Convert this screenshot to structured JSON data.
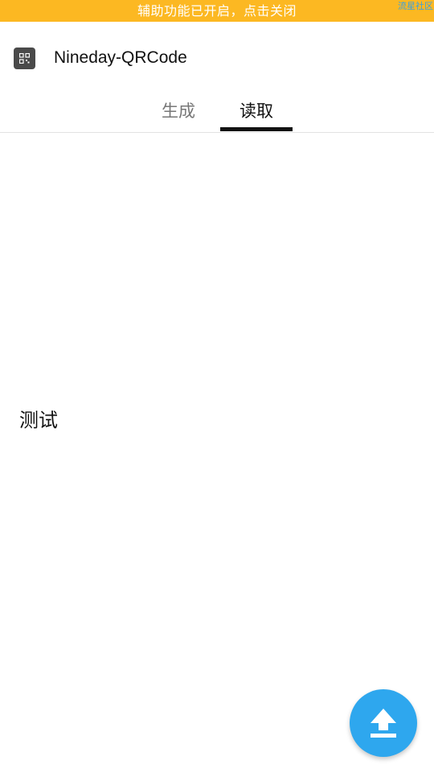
{
  "status_banner": {
    "text": "辅助功能已开启，点击关闭",
    "watermark": "流星社区",
    "background_color": "#fcb822"
  },
  "app_bar": {
    "icon": "qr-code-icon",
    "title": "Nineday-QRCode"
  },
  "tabs": [
    {
      "label": "生成",
      "selected": false
    },
    {
      "label": "读取",
      "selected": true
    }
  ],
  "content": {
    "text": "测试"
  },
  "fab": {
    "icon": "upload-icon",
    "color": "#2ea7ee"
  }
}
